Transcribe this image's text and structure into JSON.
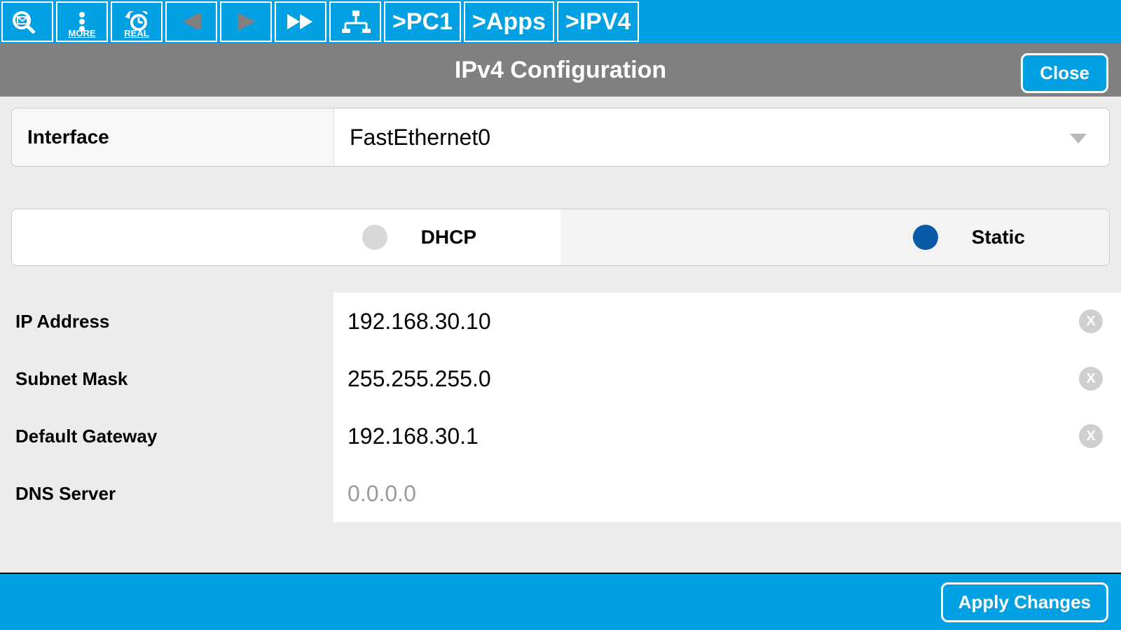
{
  "toolbar": {
    "more_label": "MORE",
    "real_label": "REAL",
    "crumbs": [
      ">PC1",
      ">Apps",
      ">IPV4"
    ]
  },
  "titlebar": {
    "title": "IPv4 Configuration",
    "close": "Close"
  },
  "interface": {
    "label": "Interface",
    "value": "FastEthernet0"
  },
  "mode": {
    "dhcp": "DHCP",
    "static": "Static",
    "selected": "static"
  },
  "fields": {
    "ip": {
      "label": "IP Address",
      "value": "192.168.30.10"
    },
    "mask": {
      "label": "Subnet Mask",
      "value": "255.255.255.0"
    },
    "gw": {
      "label": "Default Gateway",
      "value": "192.168.30.1"
    },
    "dns": {
      "label": "DNS Server",
      "value": "0.0.0.0"
    }
  },
  "footer": {
    "apply": "Apply Changes"
  }
}
